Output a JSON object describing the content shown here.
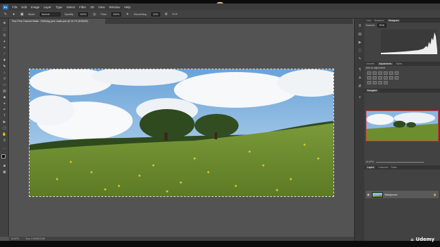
{
  "menu": {
    "app_logo": "Ps",
    "items": [
      "File",
      "Edit",
      "Image",
      "Layer",
      "Type",
      "Select",
      "Filter",
      "3D",
      "View",
      "Window",
      "Help"
    ]
  },
  "options": {
    "mode_label": "Mode:",
    "mode_value": "Normal",
    "opacity_label": "Opacity:",
    "opacity_value": "100%",
    "flow_label": "Flow:",
    "flow_value": "100%",
    "smoothing_label": "Smoothing:",
    "smoothing_value": "10%"
  },
  "document": {
    "tab_title": "Your First Channel Mask - Refining your mask.psd @ 16.7% (RGB/8*)",
    "zoom": "16.67%",
    "doc_info": "Doc: 4.00M/13.0M"
  },
  "panels": {
    "hist_tabs": [
      "Color",
      "Swatches",
      "Histogram"
    ],
    "channel_label": "Channel:",
    "channel_value": "RGB",
    "adj_tabs": [
      "Libraries",
      "Adjustments",
      "Styles"
    ],
    "adj_title": "Add an adjustment",
    "nav_tabs": [
      "Navigator"
    ],
    "nav_zoom": "16.67%",
    "layers_tabs": [
      "Layers",
      "Channels",
      "Paths"
    ],
    "layer_name": "Background"
  },
  "watermark": "Udemy",
  "colors": {
    "accent": "#1d6fb8",
    "nav_box": "#e03030"
  }
}
